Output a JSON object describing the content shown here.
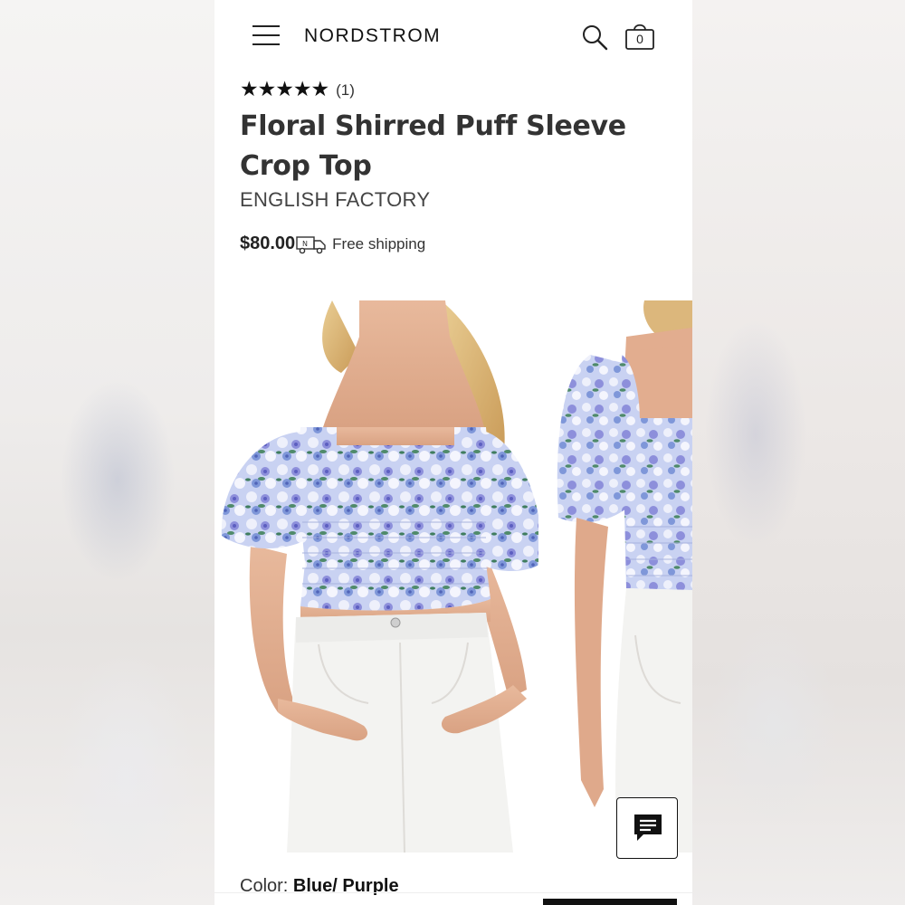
{
  "header": {
    "logo": "NORDSTROM",
    "bag_count": "0"
  },
  "product": {
    "rating_stars": "★★★★★",
    "rating": 5,
    "review_count": "(1)",
    "title": "Floral Shirred Puff Sleeve Crop Top",
    "brand": "ENGLISH FACTORY",
    "price": "$80.00",
    "shipping": "Free shipping",
    "color_label": "Color:",
    "color_value": "Blue/ Purple"
  },
  "icons": {
    "menu": "hamburger-menu-icon",
    "search": "search-icon",
    "bag": "shopping-bag-icon",
    "truck": "delivery-truck-icon",
    "chat": "chat-icon"
  },
  "colors": {
    "text": "#333333",
    "accent": "#111111",
    "floral_blue": "#8fa3dc",
    "floral_purple": "#9b8fd6",
    "leaf_green": "#4f8a6a"
  }
}
